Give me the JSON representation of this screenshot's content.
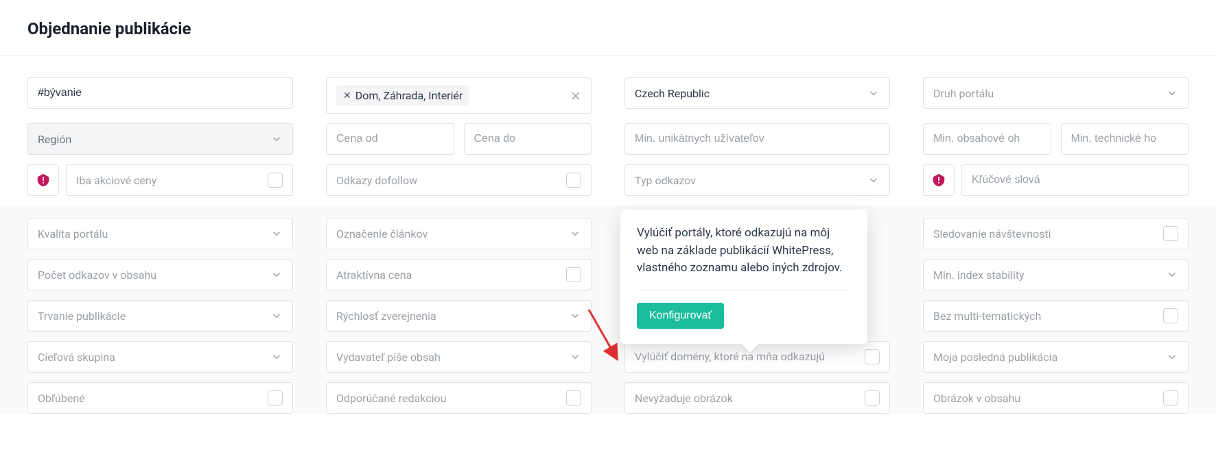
{
  "header": {
    "title": "Objednanie publikácie"
  },
  "row1": {
    "search_value": "#bývanie",
    "chip_label": "Dom, Záhrada, Interiér",
    "country_value": "Czech Republic",
    "portal_type_placeholder": "Druh portálu"
  },
  "row2": {
    "region_placeholder": "Región",
    "price_from_placeholder": "Cena od",
    "price_to_placeholder": "Cena do",
    "min_users_placeholder": "Min. unikátnych užívateľov",
    "min_content_placeholder": "Min. obsahové oh",
    "min_tech_placeholder": "Min. technické ho"
  },
  "row3": {
    "promo_placeholder": "Iba akciové ceny",
    "dofollow_placeholder": "Odkazy dofollow",
    "link_type_placeholder": "Typ odkazov",
    "keywords_placeholder": "Kľúčové slová"
  },
  "row4": {
    "quality_placeholder": "Kvalita portálu",
    "marking_placeholder": "Označenie článkov",
    "tracking_placeholder": "Sledovanie návštevnosti"
  },
  "row5": {
    "link_count_placeholder": "Počet odkazov v obsahu",
    "attractive_price_placeholder": "Atraktívna cena",
    "index_stability_placeholder": "Min. index stability"
  },
  "row6": {
    "duration_placeholder": "Trvanie publikácie",
    "speed_placeholder": "Rýchlosť zverejnenia",
    "no_multi_placeholder": "Bez multi-tematických"
  },
  "row7": {
    "target_group_placeholder": "Cieľová skupina",
    "publisher_writes_placeholder": "Vydavateľ píše obsah",
    "exclude_domains_placeholder": "Vylúčiť domény, ktoré na mňa odkazujú",
    "last_pub_placeholder": "Moja posledná publikácia"
  },
  "row8": {
    "favorite_placeholder": "Obľúbené",
    "recommended_placeholder": "Odporúčané redakciou",
    "no_image_placeholder": "Nevyžaduje obrázok",
    "image_in_content_placeholder": "Obrázok v obsahu"
  },
  "tooltip": {
    "text": "Vylúčiť portály, ktoré odkazujú na môj web na základe publikácií WhitePress, vlastného zoznamu alebo iných zdrojov.",
    "button": "Konfigurovať"
  },
  "colors": {
    "accent_teal": "#1abc9c",
    "accent_red": "#c2185b"
  }
}
